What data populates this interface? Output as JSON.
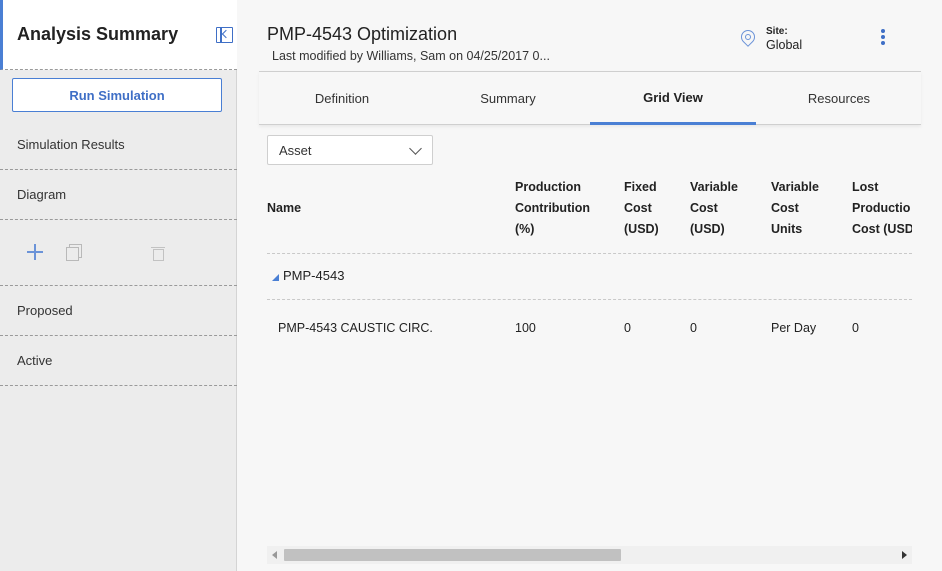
{
  "sidebar": {
    "title": "Analysis Summary",
    "run_button": "Run Simulation",
    "items": {
      "simulation_results": "Simulation Results",
      "diagram": "Diagram",
      "proposed": "Proposed",
      "active": "Active"
    },
    "toolbar_icons": [
      "plus-icon",
      "copy-icon",
      "trash-icon"
    ]
  },
  "header": {
    "title": "PMP-4543 Optimization",
    "subtitle": "Last modified by Williams, Sam on 04/25/2017 0...",
    "site_label": "Site:",
    "site_value": "Global"
  },
  "tabs": [
    "Definition",
    "Summary",
    "Grid View",
    "Resources"
  ],
  "active_tab": "Grid View",
  "filter": {
    "selected": "Asset"
  },
  "grid": {
    "columns": {
      "name": [
        "Name"
      ],
      "production_contribution": [
        "Production",
        "Contribution",
        "(%)"
      ],
      "fixed_cost": [
        "Fixed",
        "Cost",
        "(USD)"
      ],
      "variable_cost": [
        "Variable",
        "Cost",
        "(USD)"
      ],
      "variable_cost_units": [
        "Variable",
        "Cost",
        "Units"
      ],
      "lost_production_cost": [
        "Lost",
        "Productio",
        "Cost (USD"
      ]
    },
    "group": "PMP-4543",
    "row": {
      "name": "PMP-4543 CAUSTIC CIRC.",
      "production_contribution": "100",
      "fixed_cost": "0",
      "variable_cost": "0",
      "variable_cost_units": "Per Day",
      "lost_production_cost": "0"
    }
  },
  "colors": {
    "accent": "#4a7fd4",
    "sidebar_bg": "#ececec",
    "main_bg": "#f7f7f7"
  }
}
